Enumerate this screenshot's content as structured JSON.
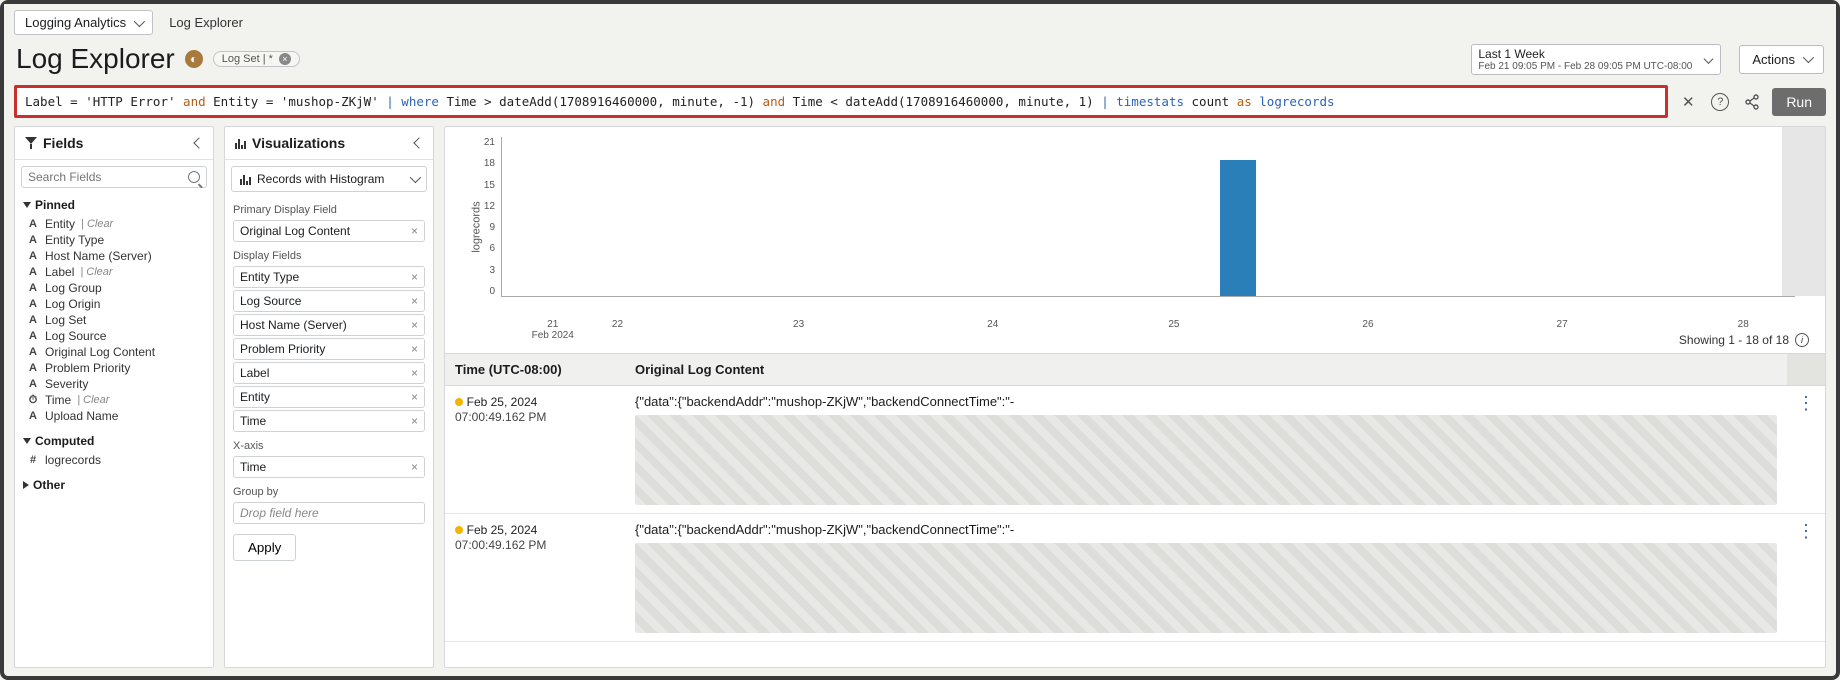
{
  "topbar": {
    "app_select_label": "Logging Analytics",
    "breadcrumb": "Log Explorer"
  },
  "title": {
    "page_title": "Log Explorer",
    "logset_pill": "Log Set | *"
  },
  "time_picker": {
    "top": "Last 1 Week",
    "sub": "Feb 21 09:05 PM - Feb 28 09:05 PM UTC-08:00"
  },
  "actions_label": "Actions",
  "query": {
    "p1": "Label = 'HTTP Error' ",
    "op_and1": "and",
    "p2": " Entity = 'mushop-ZKjW' ",
    "pipe1": "|",
    "kw_where": " where ",
    "p3": "Time > dateAdd(1708916460000, minute, -1) ",
    "op_and2": "and",
    "p4": " Time < dateAdd(1708916460000, minute, 1) ",
    "pipe2": "|",
    "kw_timestats": " timestats ",
    "p5": "count ",
    "op_as": "as",
    "p6": " logrecords"
  },
  "run_label": "Run",
  "fields_panel": {
    "title": "Fields",
    "search_placeholder": "Search Fields",
    "pinned_label": "Pinned",
    "pinned": [
      {
        "t": "A",
        "n": "Entity",
        "clear": true
      },
      {
        "t": "A",
        "n": "Entity Type"
      },
      {
        "t": "A",
        "n": "Host Name (Server)"
      },
      {
        "t": "A",
        "n": "Label",
        "clear": true
      },
      {
        "t": "A",
        "n": "Log Group"
      },
      {
        "t": "A",
        "n": "Log Origin"
      },
      {
        "t": "A",
        "n": "Log Set"
      },
      {
        "t": "A",
        "n": "Log Source"
      },
      {
        "t": "A",
        "n": "Original Log Content"
      },
      {
        "t": "A",
        "n": "Problem Priority"
      },
      {
        "t": "A",
        "n": "Severity"
      },
      {
        "t": "⏱",
        "n": "Time",
        "clear": true
      },
      {
        "t": "A",
        "n": "Upload Name"
      }
    ],
    "computed_label": "Computed",
    "computed": [
      {
        "t": "#",
        "n": "logrecords"
      }
    ],
    "other_label": "Other",
    "clear_text": "Clear"
  },
  "viz_panel": {
    "title": "Visualizations",
    "viz_select": "Records with Histogram",
    "primary_label": "Primary Display Field",
    "primary_field": "Original Log Content",
    "display_label": "Display Fields",
    "display_fields": [
      "Entity Type",
      "Log Source",
      "Host Name (Server)",
      "Problem Priority",
      "Label",
      "Entity",
      "Time"
    ],
    "xaxis_label": "X-axis",
    "xaxis_value": "Time",
    "groupby_label": "Group by",
    "groupby_placeholder": "Drop field here",
    "apply_label": "Apply"
  },
  "chart_data": {
    "type": "bar",
    "ylabel": "logrecords",
    "yticks": [
      21,
      18,
      15,
      12,
      9,
      6,
      3,
      0
    ],
    "xticks": [
      {
        "label": "21\nFeb 2024",
        "pos": 4
      },
      {
        "label": "22",
        "pos": 9
      },
      {
        "label": "23",
        "pos": 23
      },
      {
        "label": "24",
        "pos": 38
      },
      {
        "label": "25",
        "pos": 52
      },
      {
        "label": "26",
        "pos": 67
      },
      {
        "label": "27",
        "pos": 82
      },
      {
        "label": "28",
        "pos": 96
      }
    ],
    "bars": [
      {
        "pos": 55.5,
        "value": 18
      }
    ],
    "ghost_pos": 99
  },
  "results": {
    "showing": "Showing 1 - 18 of 18",
    "col_time": "Time (UTC-08:00)",
    "col_content": "Original Log Content",
    "rows": [
      {
        "date": "Feb 25, 2024",
        "time": "07:00:49.162 PM",
        "content": "{\"data\":{\"backendAddr\":\"mushop-ZKjW\",\"backendConnectTime\":\"-"
      },
      {
        "date": "Feb 25, 2024",
        "time": "07:00:49.162 PM",
        "content": "{\"data\":{\"backendAddr\":\"mushop-ZKjW\",\"backendConnectTime\":\"-"
      }
    ]
  }
}
